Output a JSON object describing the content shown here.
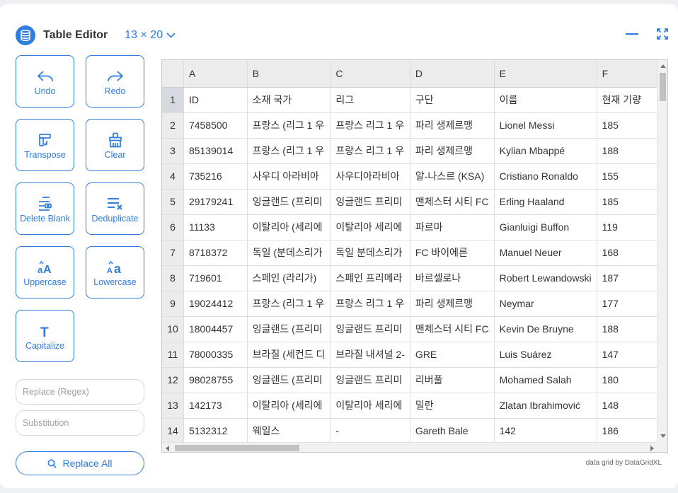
{
  "app": {
    "title": "Table Editor",
    "dimensions": "13 × 20",
    "accent_color": "#2f7de1"
  },
  "header_actions": [
    {
      "name": "minimize-icon"
    },
    {
      "name": "fullscreen-icon"
    }
  ],
  "tools": [
    {
      "id": "undo",
      "label": "Undo",
      "icon": "undo-icon"
    },
    {
      "id": "redo",
      "label": "Redo",
      "icon": "redo-icon"
    },
    {
      "id": "transpose",
      "label": "Transpose",
      "icon": "transpose-icon"
    },
    {
      "id": "clear",
      "label": "Clear",
      "icon": "broom-icon"
    },
    {
      "id": "delete-blank",
      "label": "Delete Blank",
      "icon": "delete-blank-icon"
    },
    {
      "id": "deduplicate",
      "label": "Deduplicate",
      "icon": "deduplicate-icon"
    },
    {
      "id": "uppercase",
      "label": "Uppercase",
      "icon": "uppercase-icon"
    },
    {
      "id": "lowercase",
      "label": "Lowercase",
      "icon": "lowercase-icon"
    },
    {
      "id": "capitalize",
      "label": "Capitalize",
      "icon": "capitalize-icon"
    }
  ],
  "replace": {
    "regex_placeholder": "Replace (Regex)",
    "regex_value": "",
    "substitution_placeholder": "Substitution",
    "substitution_value": "",
    "button_label": "Replace All"
  },
  "grid": {
    "columns": [
      "A",
      "B",
      "C",
      "D",
      "E",
      "F"
    ],
    "active_row": 1,
    "rows": [
      {
        "n": "1",
        "cells": [
          "ID",
          "소재 국가",
          "리그",
          "구단",
          "이름",
          "현재 기량"
        ]
      },
      {
        "n": "2",
        "cells": [
          "7458500",
          "프랑스 (리그 1 우",
          "프랑스 리그 1 우",
          "파리 생제르맹",
          "Lionel Messi",
          "185"
        ]
      },
      {
        "n": "3",
        "cells": [
          "85139014",
          "프랑스 (리그 1 우",
          "프랑스 리그 1 우",
          "파리 생제르맹",
          "Kylian Mbappé",
          "188"
        ]
      },
      {
        "n": "4",
        "cells": [
          "735216",
          "사우디 아라비아",
          "사우디아라비아",
          "알-나스르 (KSA)",
          "Cristiano Ronaldo",
          "155"
        ]
      },
      {
        "n": "5",
        "cells": [
          "29179241",
          "잉글랜드 (프리미",
          "잉글랜드 프리미",
          "맨체스터 시티 FC",
          "Erling Haaland",
          "185"
        ]
      },
      {
        "n": "6",
        "cells": [
          "11133",
          "이탈리아 (세리에",
          "이탈리아 세리에",
          "파르마",
          "Gianluigi Buffon",
          "119"
        ]
      },
      {
        "n": "7",
        "cells": [
          "8718372",
          "독일 (분데스리가",
          "독일 분데스리가",
          "FC 바이에른",
          "Manuel Neuer",
          "168"
        ]
      },
      {
        "n": "8",
        "cells": [
          "719601",
          "스페인 (라리가)",
          "스페인 프리메라",
          "바르셀로나",
          "Robert Lewandowski",
          "187"
        ]
      },
      {
        "n": "9",
        "cells": [
          "19024412",
          "프랑스 (리그 1 우",
          "프랑스 리그 1 우",
          "파리 생제르맹",
          "Neymar",
          "177"
        ]
      },
      {
        "n": "10",
        "cells": [
          "18004457",
          "잉글랜드 (프리미",
          "잉글랜드 프리미",
          "맨체스터 시티 FC",
          "Kevin De Bruyne",
          "188"
        ]
      },
      {
        "n": "11",
        "cells": [
          "78000335",
          "브라질 (세컨드 디",
          "브라질 내셔널 2-",
          "GRE",
          "Luis Suárez",
          "147"
        ]
      },
      {
        "n": "12",
        "cells": [
          "98028755",
          "잉글랜드 (프리미",
          "잉글랜드 프리미",
          "리버풀",
          "Mohamed Salah",
          "180"
        ]
      },
      {
        "n": "13",
        "cells": [
          "142173",
          "이탈리아 (세리에",
          "이탈리아 세리에",
          "밀란",
          "Zlatan Ibrahimović",
          "148"
        ]
      },
      {
        "n": "14",
        "cells": [
          "5132312",
          "웨일스",
          "-",
          "Gareth Bale",
          "142",
          "186"
        ]
      }
    ]
  },
  "credit": "data grid by DataGridXL"
}
